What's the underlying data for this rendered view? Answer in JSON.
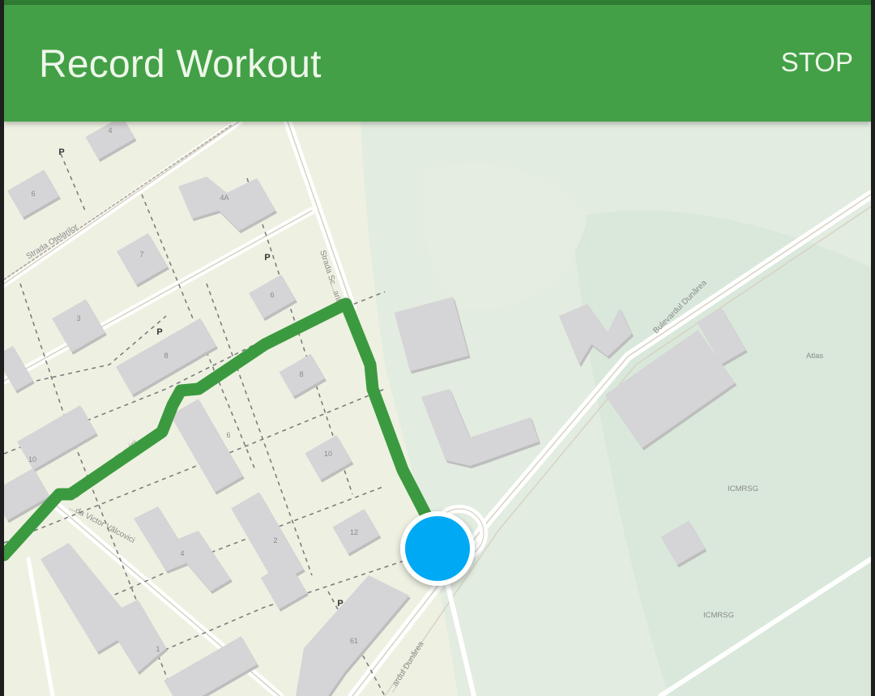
{
  "toolbar": {
    "title": "Record Workout",
    "stop_label": "STOP",
    "color": "#43a047"
  },
  "map": {
    "route_color": "#3b9a3f",
    "location_color": "#03a9f4",
    "street_labels": {
      "otelarilor": "Strada Oțelarilor",
      "sc": "Strada Sc...arilor",
      "dunarea_upper": "Bulevardul Dunărea",
      "dunarea_lower": "...ardul Dunărea",
      "valcovici_1": "...ardul Victor Vâlcovici",
      "valcovici_2": "...da Victor Vâlcovici"
    },
    "place_labels": {
      "atlas": "Atlas",
      "icmrsg_1": "ICMRSG",
      "icmrsg_2": "ICMRSG"
    },
    "building_numbers": {
      "b4": "4",
      "b6a": "6",
      "b4a": "4A",
      "b7": "7",
      "b6b": "6",
      "b3": "3",
      "b8a": "8",
      "b8b": "8",
      "b10a": "10",
      "b6c": "6",
      "b10b": "10",
      "b12": "12",
      "b2": "2",
      "b4b": "4",
      "b1": "1",
      "b61": "61"
    },
    "parking": {
      "p1": "P",
      "p2": "P",
      "p3": "P",
      "p4": "P"
    }
  }
}
